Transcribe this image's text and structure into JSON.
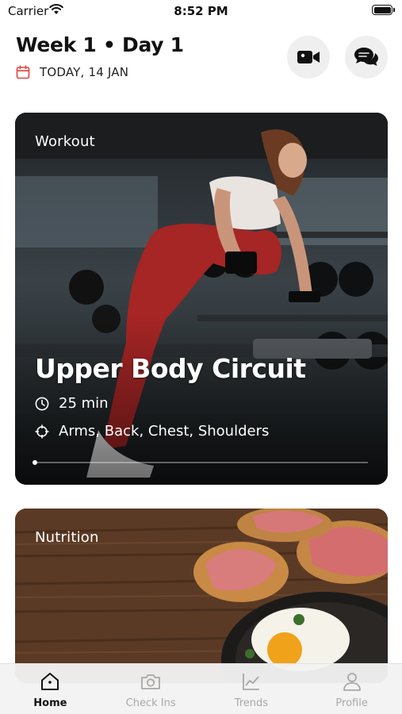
{
  "status_bar": {
    "carrier": "Carrier",
    "time": "8:52 PM"
  },
  "header": {
    "title": "Week 1 • Day 1",
    "date": "TODAY, 14 JAN",
    "accent_color": "#e8413c"
  },
  "workout_card": {
    "label": "Workout",
    "title": "Upper Body Circuit",
    "duration": "25 min",
    "muscles": "Arms, Back, Chest, Shoulders",
    "progress": 0
  },
  "nutrition_card": {
    "label": "Nutrition"
  },
  "tabs": [
    {
      "label": "Home",
      "icon": "home-icon",
      "active": true
    },
    {
      "label": "Check Ins",
      "icon": "camera-icon",
      "active": false
    },
    {
      "label": "Trends",
      "icon": "trends-chart-icon",
      "active": false
    },
    {
      "label": "Profile",
      "icon": "profile-icon",
      "active": false
    }
  ]
}
